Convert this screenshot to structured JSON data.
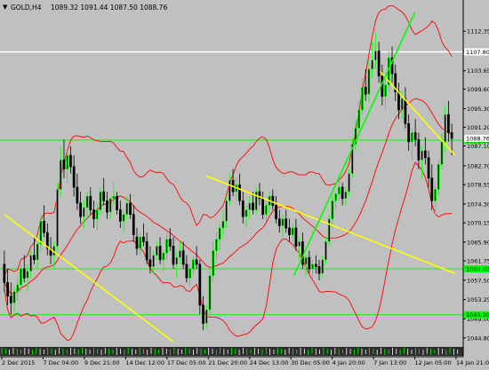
{
  "window": {
    "symbol_label": "GOLD,H4",
    "ohlc_label": "1089.32 1091.44 1087.50 1088.76",
    "menu_arrow": "▼"
  },
  "colors": {
    "background": "#c0c0c0",
    "bull": "#00ff00",
    "bear": "#000000",
    "bollinger": "#ff0000",
    "trendline": "#ffff00",
    "uptrend": "#00ff00",
    "level_green": "#00ff00",
    "level_white": "#ffffff",
    "axis_text": "#000000"
  },
  "chart_data": {
    "type": "candlestick",
    "title": "GOLD,H4",
    "y_ticks": [
      1112.35,
      1107.95,
      1103.65,
      1099.6,
      1095.3,
      1091.2,
      1087.1,
      1082.7,
      1078.55,
      1074.3,
      1070.15,
      1065.9,
      1061.75,
      1057.5,
      1053.25,
      1049.0,
      1044.8
    ],
    "y_tick_labels": [
      "1112.35",
      "1107.95",
      "1103.65",
      "1099.60",
      "1095.30",
      "1091.20",
      "1087.10",
      "1082.70",
      "1078.55",
      "1074.30",
      "1070.15",
      "1065.90",
      "1061.75",
      "1057.50",
      "1053.25",
      "1049.00",
      "1044.80"
    ],
    "x_tick_labels": [
      "2 Dec 2015",
      "7 Dec 04:00",
      "9 Dec 21:00",
      "14 Dec 12:00",
      "17 Dec 05:00",
      "21 Dec 20:00",
      "24 Dec 13:00",
      "30 Dec 05:00",
      "4 Jan 20:00",
      "7 Jan 13:00",
      "12 Jan 05:00",
      "14 Jan 21:00"
    ],
    "ylim": [
      1043.0,
      1116.5
    ],
    "horizontal_levels": [
      {
        "price": 1107.8,
        "label": "1107.80",
        "color": "white"
      },
      {
        "price": 1088.38,
        "label": "1088.38",
        "color": "green"
      },
      {
        "price": 1060.0,
        "label": "1060.00",
        "color": "green"
      },
      {
        "price": 1049.9,
        "label": "1049.90",
        "color": "green"
      }
    ],
    "price_label_current": "1088.76",
    "trendlines": [
      {
        "color": "yellow",
        "from_bar": 0,
        "from_price": 1072.0,
        "to_bar": 92,
        "to_price": 1044.0
      },
      {
        "color": "yellow",
        "from_bar": 110,
        "from_price": 1080.5,
        "to_bar": 246,
        "to_price": 1059.0
      },
      {
        "color": "yellow",
        "from_bar": 205,
        "from_price": 1103.5,
        "to_bar": 246,
        "to_price": 1085.0
      },
      {
        "color": "green",
        "from_bar": 158,
        "from_price": 1058.5,
        "to_bar": 224,
        "to_price": 1116.5
      }
    ],
    "bollinger": {
      "period": 20,
      "deviation": 2
    },
    "candles_description": "Daily-ish H4 gold candles from 2 Dec 2015 to 14 Jan 2016, price ranging ~1046 to ~1112",
    "candles": [
      [
        1061.0,
        1064.0,
        1055.0,
        1057.0
      ],
      [
        1057.0,
        1060.0,
        1052.0,
        1054.0
      ],
      [
        1054.0,
        1057.0,
        1050.0,
        1052.5
      ],
      [
        1052.5,
        1056.0,
        1049.5,
        1055.0
      ],
      [
        1055.0,
        1058.0,
        1053.0,
        1056.5
      ],
      [
        1056.5,
        1061.0,
        1055.0,
        1060.0
      ],
      [
        1060.0,
        1063.0,
        1057.0,
        1058.0
      ],
      [
        1058.0,
        1061.0,
        1055.0,
        1059.5
      ],
      [
        1059.5,
        1064.0,
        1058.0,
        1063.0
      ],
      [
        1063.0,
        1067.0,
        1061.0,
        1062.0
      ],
      [
        1062.0,
        1066.0,
        1060.0,
        1065.5
      ],
      [
        1065.5,
        1072.0,
        1064.0,
        1070.5
      ],
      [
        1070.5,
        1074.0,
        1067.0,
        1068.0
      ],
      [
        1068.0,
        1070.0,
        1063.0,
        1064.5
      ],
      [
        1064.5,
        1067.0,
        1061.0,
        1063.0
      ],
      [
        1063.0,
        1066.0,
        1060.0,
        1065.0
      ],
      [
        1065.0,
        1079.0,
        1064.0,
        1077.5
      ],
      [
        1077.5,
        1087.0,
        1076.0,
        1084.0
      ],
      [
        1084.0,
        1088.5,
        1080.0,
        1082.0
      ],
      [
        1082.0,
        1086.0,
        1079.0,
        1085.0
      ],
      [
        1085.0,
        1087.0,
        1081.0,
        1082.5
      ],
      [
        1082.5,
        1085.0,
        1076.0,
        1078.0
      ],
      [
        1078.0,
        1081.0,
        1073.0,
        1074.5
      ],
      [
        1074.5,
        1077.0,
        1070.0,
        1071.5
      ],
      [
        1071.5,
        1075.0,
        1069.0,
        1073.5
      ],
      [
        1073.5,
        1077.0,
        1071.0,
        1076.0
      ],
      [
        1076.0,
        1078.0,
        1072.0,
        1073.0
      ],
      [
        1073.0,
        1075.0,
        1069.0,
        1071.0
      ],
      [
        1071.0,
        1074.5,
        1068.5,
        1073.0
      ],
      [
        1073.0,
        1078.0,
        1072.0,
        1077.0
      ],
      [
        1077.0,
        1080.0,
        1074.0,
        1075.0
      ],
      [
        1075.0,
        1077.0,
        1071.0,
        1072.5
      ],
      [
        1072.5,
        1076.0,
        1071.0,
        1075.5
      ],
      [
        1075.5,
        1079.0,
        1074.0,
        1076.0
      ],
      [
        1076.0,
        1077.0,
        1072.0,
        1073.0
      ],
      [
        1073.0,
        1075.0,
        1069.0,
        1070.5
      ],
      [
        1070.5,
        1073.0,
        1068.0,
        1072.0
      ],
      [
        1072.0,
        1076.0,
        1071.0,
        1074.5
      ],
      [
        1074.5,
        1076.5,
        1071.0,
        1072.0
      ],
      [
        1072.0,
        1074.0,
        1066.0,
        1067.5
      ],
      [
        1067.0,
        1069.0,
        1063.0,
        1064.5
      ],
      [
        1064.5,
        1068.0,
        1063.0,
        1067.0
      ],
      [
        1067.0,
        1070.0,
        1065.0,
        1066.0
      ],
      [
        1066.0,
        1068.0,
        1061.0,
        1062.0
      ],
      [
        1062.0,
        1065.0,
        1059.0,
        1060.5
      ],
      [
        1060.5,
        1064.0,
        1059.0,
        1063.0
      ],
      [
        1063.0,
        1066.0,
        1062.0,
        1065.0
      ],
      [
        1065.0,
        1067.0,
        1061.0,
        1062.0
      ],
      [
        1062.0,
        1064.0,
        1059.5,
        1063.5
      ],
      [
        1063.5,
        1068.0,
        1062.0,
        1066.5
      ],
      [
        1066.5,
        1069.0,
        1064.0,
        1065.0
      ],
      [
        1065.0,
        1067.0,
        1060.0,
        1061.0
      ],
      [
        1061.0,
        1064.0,
        1058.0,
        1062.5
      ],
      [
        1062.5,
        1066.0,
        1061.0,
        1064.0
      ],
      [
        1064.0,
        1066.0,
        1060.0,
        1061.0
      ],
      [
        1061.0,
        1063.0,
        1057.0,
        1058.0
      ],
      [
        1058.0,
        1061.0,
        1056.0,
        1060.0
      ],
      [
        1060.0,
        1063.0,
        1058.5,
        1062.0
      ],
      [
        1062.0,
        1065.0,
        1060.0,
        1061.0
      ],
      [
        1061.0,
        1062.0,
        1050.0,
        1052.0
      ],
      [
        1052.0,
        1054.0,
        1046.5,
        1048.0
      ],
      [
        1048.0,
        1052.0,
        1047.0,
        1051.0
      ],
      [
        1051.0,
        1060.0,
        1050.0,
        1058.5
      ],
      [
        1058.5,
        1066.0,
        1057.0,
        1064.0
      ],
      [
        1064.0,
        1068.0,
        1062.0,
        1066.5
      ],
      [
        1066.5,
        1070.0,
        1064.0,
        1069.0
      ],
      [
        1069.0,
        1073.0,
        1067.0,
        1070.5
      ],
      [
        1070.5,
        1076.0,
        1069.0,
        1075.0
      ],
      [
        1075.0,
        1081.0,
        1074.0,
        1079.5
      ],
      [
        1079.5,
        1082.0,
        1076.0,
        1077.0
      ],
      [
        1077.0,
        1080.0,
        1075.0,
        1078.5
      ],
      [
        1078.5,
        1081.0,
        1074.0,
        1075.0
      ],
      [
        1075.0,
        1077.0,
        1070.0,
        1071.5
      ],
      [
        1071.5,
        1074.0,
        1069.0,
        1073.0
      ],
      [
        1073.0,
        1076.0,
        1071.0,
        1074.5
      ],
      [
        1074.5,
        1077.0,
        1072.0,
        1073.0
      ],
      [
        1073.0,
        1078.0,
        1072.0,
        1077.0
      ],
      [
        1077.0,
        1079.0,
        1074.0,
        1075.5
      ],
      [
        1075.5,
        1077.0,
        1071.0,
        1072.0
      ],
      [
        1072.0,
        1075.0,
        1070.5,
        1074.0
      ],
      [
        1074.0,
        1077.0,
        1072.5,
        1076.0
      ],
      [
        1076.0,
        1077.5,
        1073.0,
        1074.0
      ],
      [
        1074.0,
        1076.0,
        1070.0,
        1071.0
      ],
      [
        1071.0,
        1073.0,
        1068.0,
        1069.5
      ],
      [
        1069.5,
        1072.0,
        1067.0,
        1071.0
      ],
      [
        1071.0,
        1073.0,
        1068.0,
        1069.0
      ],
      [
        1069.0,
        1071.0,
        1066.0,
        1067.5
      ],
      [
        1067.5,
        1070.0,
        1066.0,
        1069.0
      ],
      [
        1069.0,
        1071.0,
        1064.0,
        1065.0
      ],
      [
        1065.0,
        1067.0,
        1062.0,
        1066.0
      ],
      [
        1066.0,
        1068.0,
        1060.0,
        1061.0
      ],
      [
        1061.0,
        1063.0,
        1058.5,
        1062.5
      ],
      [
        1062.5,
        1064.0,
        1059.0,
        1060.0
      ],
      [
        1060.0,
        1062.0,
        1058.0,
        1061.0
      ],
      [
        1061.0,
        1063.0,
        1059.0,
        1060.5
      ],
      [
        1060.5,
        1062.0,
        1057.5,
        1059.0
      ],
      [
        1059.0,
        1063.0,
        1058.0,
        1062.0
      ],
      [
        1062.0,
        1067.0,
        1061.0,
        1066.0
      ],
      [
        1066.0,
        1072.0,
        1065.0,
        1071.0
      ],
      [
        1071.0,
        1076.0,
        1069.0,
        1075.0
      ],
      [
        1075.0,
        1077.0,
        1073.0,
        1076.5
      ],
      [
        1076.5,
        1080.0,
        1075.0,
        1078.0
      ],
      [
        1078.0,
        1079.0,
        1074.0,
        1075.5
      ],
      [
        1075.5,
        1078.0,
        1074.0,
        1077.0
      ],
      [
        1077.0,
        1082.0,
        1076.0,
        1081.0
      ],
      [
        1081.0,
        1089.0,
        1080.0,
        1087.5
      ],
      [
        1087.5,
        1093.0,
        1086.0,
        1091.0
      ],
      [
        1091.0,
        1097.0,
        1090.0,
        1095.0
      ],
      [
        1095.0,
        1102.0,
        1094.0,
        1100.0
      ],
      [
        1100.0,
        1104.0,
        1097.0,
        1098.5
      ],
      [
        1098.5,
        1106.0,
        1097.0,
        1104.0
      ],
      [
        1104.0,
        1110.0,
        1102.0,
        1106.0
      ],
      [
        1106.0,
        1112.0,
        1104.0,
        1108.0
      ],
      [
        1108.0,
        1110.0,
        1101.0,
        1102.5
      ],
      [
        1102.5,
        1105.0,
        1096.0,
        1098.0
      ],
      [
        1098.0,
        1102.0,
        1095.0,
        1100.5
      ],
      [
        1100.5,
        1108.0,
        1099.0,
        1106.5
      ],
      [
        1106.5,
        1109.0,
        1101.0,
        1103.0
      ],
      [
        1103.0,
        1105.0,
        1097.0,
        1099.0
      ],
      [
        1099.0,
        1101.0,
        1093.0,
        1095.0
      ],
      [
        1095.0,
        1099.0,
        1093.0,
        1097.5
      ],
      [
        1097.5,
        1100.0,
        1091.0,
        1092.0
      ],
      [
        1092.0,
        1094.0,
        1086.0,
        1088.0
      ],
      [
        1088.0,
        1091.0,
        1084.0,
        1090.0
      ],
      [
        1090.0,
        1093.0,
        1087.0,
        1088.5
      ],
      [
        1088.5,
        1090.0,
        1082.0,
        1084.0
      ],
      [
        1084.0,
        1087.0,
        1080.0,
        1086.0
      ],
      [
        1086.0,
        1089.0,
        1083.0,
        1084.5
      ],
      [
        1084.5,
        1086.0,
        1078.0,
        1080.0
      ],
      [
        1080.0,
        1083.0,
        1073.0,
        1075.0
      ],
      [
        1075.0,
        1079.0,
        1072.0,
        1077.5
      ],
      [
        1077.5,
        1084.0,
        1076.0,
        1083.0
      ],
      [
        1083.0,
        1090.0,
        1082.0,
        1088.0
      ],
      [
        1088.0,
        1096.0,
        1086.0,
        1094.0
      ],
      [
        1094.0,
        1097.0,
        1088.0,
        1090.0
      ],
      [
        1090.0,
        1092.0,
        1085.0,
        1088.76
      ]
    ]
  }
}
